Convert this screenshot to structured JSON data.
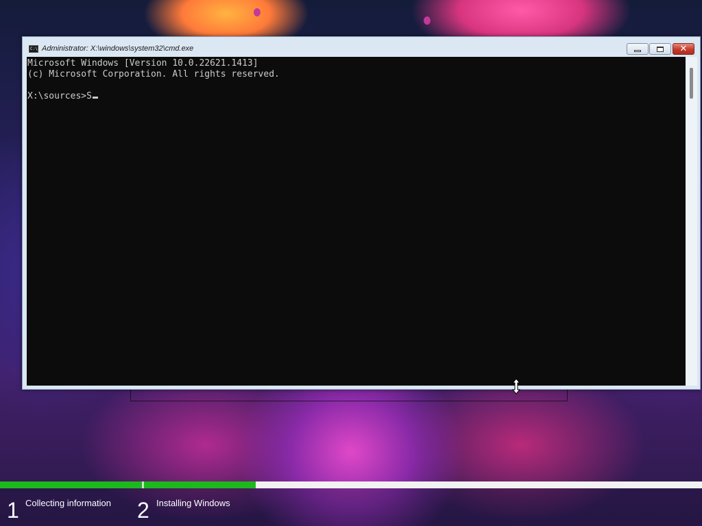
{
  "window": {
    "title": "Administrator: X:\\windows\\system32\\cmd.exe",
    "icon": "cmd-icon",
    "icon_text": "C:\\"
  },
  "console": {
    "lines": [
      "Microsoft Windows [Version 10.0.22621.1413]",
      "(c) Microsoft Corporation. All rights reserved.",
      "",
      "X:\\sources>S"
    ]
  },
  "setup": {
    "progress_segments_complete": 1,
    "steps": [
      {
        "number": "1",
        "label": "Collecting information"
      },
      {
        "number": "2",
        "label": "Installing Windows"
      }
    ]
  },
  "colors": {
    "progress": "#1db81d",
    "console_bg": "#0c0c0c",
    "console_fg": "#cccccc",
    "close_button": "#c43b2c"
  }
}
